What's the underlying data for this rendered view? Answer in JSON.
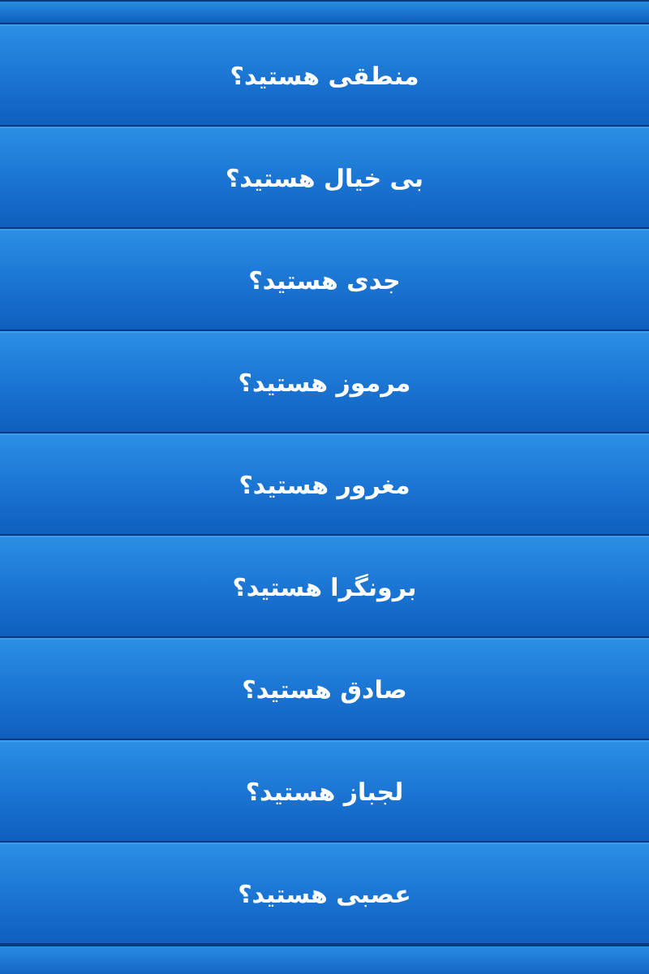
{
  "items": [
    {
      "label": "منطقی هستید؟"
    },
    {
      "label": "بی خیال هستید؟"
    },
    {
      "label": "جدی هستید؟"
    },
    {
      "label": "مرموز هستید؟"
    },
    {
      "label": "مغرور هستید؟"
    },
    {
      "label": "برونگرا هستید؟"
    },
    {
      "label": "صادق هستید؟"
    },
    {
      "label": "لجباز هستید؟"
    },
    {
      "label": "عصبی هستید؟"
    }
  ]
}
